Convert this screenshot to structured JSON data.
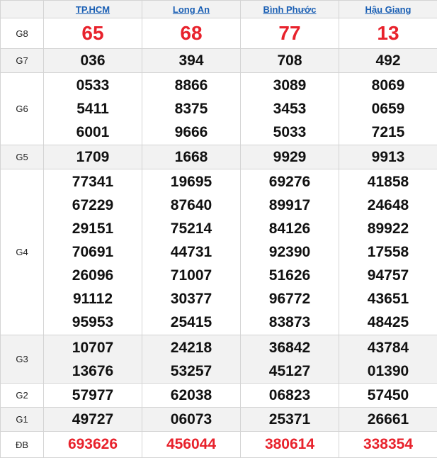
{
  "header": {
    "provinces": [
      "TP.HCM",
      "Long An",
      "Bình Phước",
      "Hậu Giang"
    ]
  },
  "rows": [
    {
      "label": "G8",
      "style": "big",
      "alt": false,
      "values": [
        [
          "65"
        ],
        [
          "68"
        ],
        [
          "77"
        ],
        [
          "13"
        ]
      ]
    },
    {
      "label": "G7",
      "style": "num",
      "alt": true,
      "values": [
        [
          "036"
        ],
        [
          "394"
        ],
        [
          "708"
        ],
        [
          "492"
        ]
      ]
    },
    {
      "label": "G6",
      "style": "num",
      "alt": false,
      "values": [
        [
          "0533",
          "5411",
          "6001"
        ],
        [
          "8866",
          "8375",
          "9666"
        ],
        [
          "3089",
          "3453",
          "5033"
        ],
        [
          "8069",
          "0659",
          "7215"
        ]
      ]
    },
    {
      "label": "G5",
      "style": "num",
      "alt": true,
      "values": [
        [
          "1709"
        ],
        [
          "1668"
        ],
        [
          "9929"
        ],
        [
          "9913"
        ]
      ]
    },
    {
      "label": "G4",
      "style": "num",
      "alt": false,
      "values": [
        [
          "77341",
          "67229",
          "29151",
          "70691",
          "26096",
          "91112",
          "95953"
        ],
        [
          "19695",
          "87640",
          "75214",
          "44731",
          "71007",
          "30377",
          "25415"
        ],
        [
          "69276",
          "89917",
          "84126",
          "92390",
          "51626",
          "96772",
          "83873"
        ],
        [
          "41858",
          "24648",
          "89922",
          "17558",
          "94757",
          "43651",
          "48425"
        ]
      ]
    },
    {
      "label": "G3",
      "style": "num",
      "alt": true,
      "values": [
        [
          "10707",
          "13676"
        ],
        [
          "24218",
          "53257"
        ],
        [
          "36842",
          "45127"
        ],
        [
          "43784",
          "01390"
        ]
      ]
    },
    {
      "label": "G2",
      "style": "num",
      "alt": false,
      "values": [
        [
          "57977"
        ],
        [
          "62038"
        ],
        [
          "06823"
        ],
        [
          "57450"
        ]
      ]
    },
    {
      "label": "G1",
      "style": "num",
      "alt": true,
      "values": [
        [
          "49727"
        ],
        [
          "06073"
        ],
        [
          "25371"
        ],
        [
          "26661"
        ]
      ]
    },
    {
      "label": "ĐB",
      "style": "special",
      "alt": false,
      "values": [
        [
          "693626"
        ],
        [
          "456044"
        ],
        [
          "380614"
        ],
        [
          "338354"
        ]
      ]
    }
  ],
  "colors": {
    "prize_red": "#e8222c",
    "link_blue": "#1a5fb4",
    "alt_row": "#f2f2f2",
    "border": "#d4d4d4"
  }
}
